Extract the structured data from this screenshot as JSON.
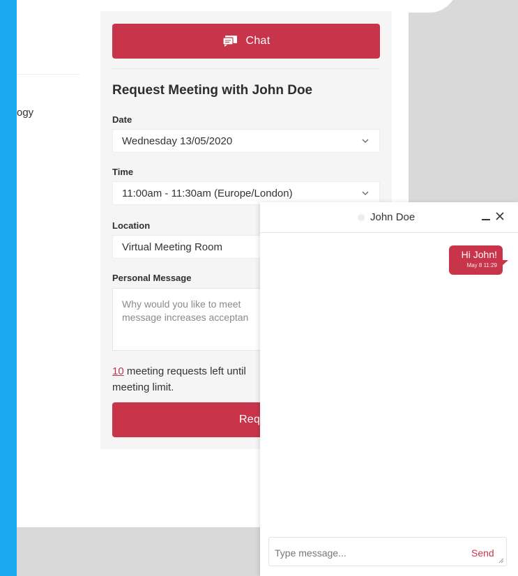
{
  "left_column": {
    "partial_text": "ogy"
  },
  "meeting_panel": {
    "chat_button_label": "Chat",
    "title": "Request Meeting with John Doe",
    "date": {
      "label": "Date",
      "value": "Wednesday 13/05/2020"
    },
    "time": {
      "label": "Time",
      "value": "11:00am - 11:30am (Europe/London)"
    },
    "location": {
      "label": "Location",
      "value": "Virtual Meeting Room"
    },
    "personal_message": {
      "label": "Personal Message",
      "placeholder_line1": "Why would you like to meet",
      "placeholder_line2": "message increases acceptan"
    },
    "quota": {
      "count": "10",
      "text_line1": " meeting requests left until",
      "text_line2": "meeting limit."
    },
    "request_button_label": "Request M"
  },
  "chat_window": {
    "contact_name": "John Doe",
    "messages": [
      {
        "text": "Hi John!",
        "time": "May 8 11:29"
      }
    ],
    "input_placeholder": "Type message...",
    "send_label": "Send"
  },
  "colors": {
    "accent": "#c8354b",
    "outer_background": "#1aa9ee",
    "panel_background": "#f5f5f5",
    "gray_area": "#d9d9d9"
  },
  "icons": {
    "chat_button": "chat-bubbles-icon",
    "dropdowns": "chevron-down-icon",
    "chat_minimize": "minimize-icon",
    "chat_close": "close-icon",
    "status": "status-dot-icon"
  }
}
